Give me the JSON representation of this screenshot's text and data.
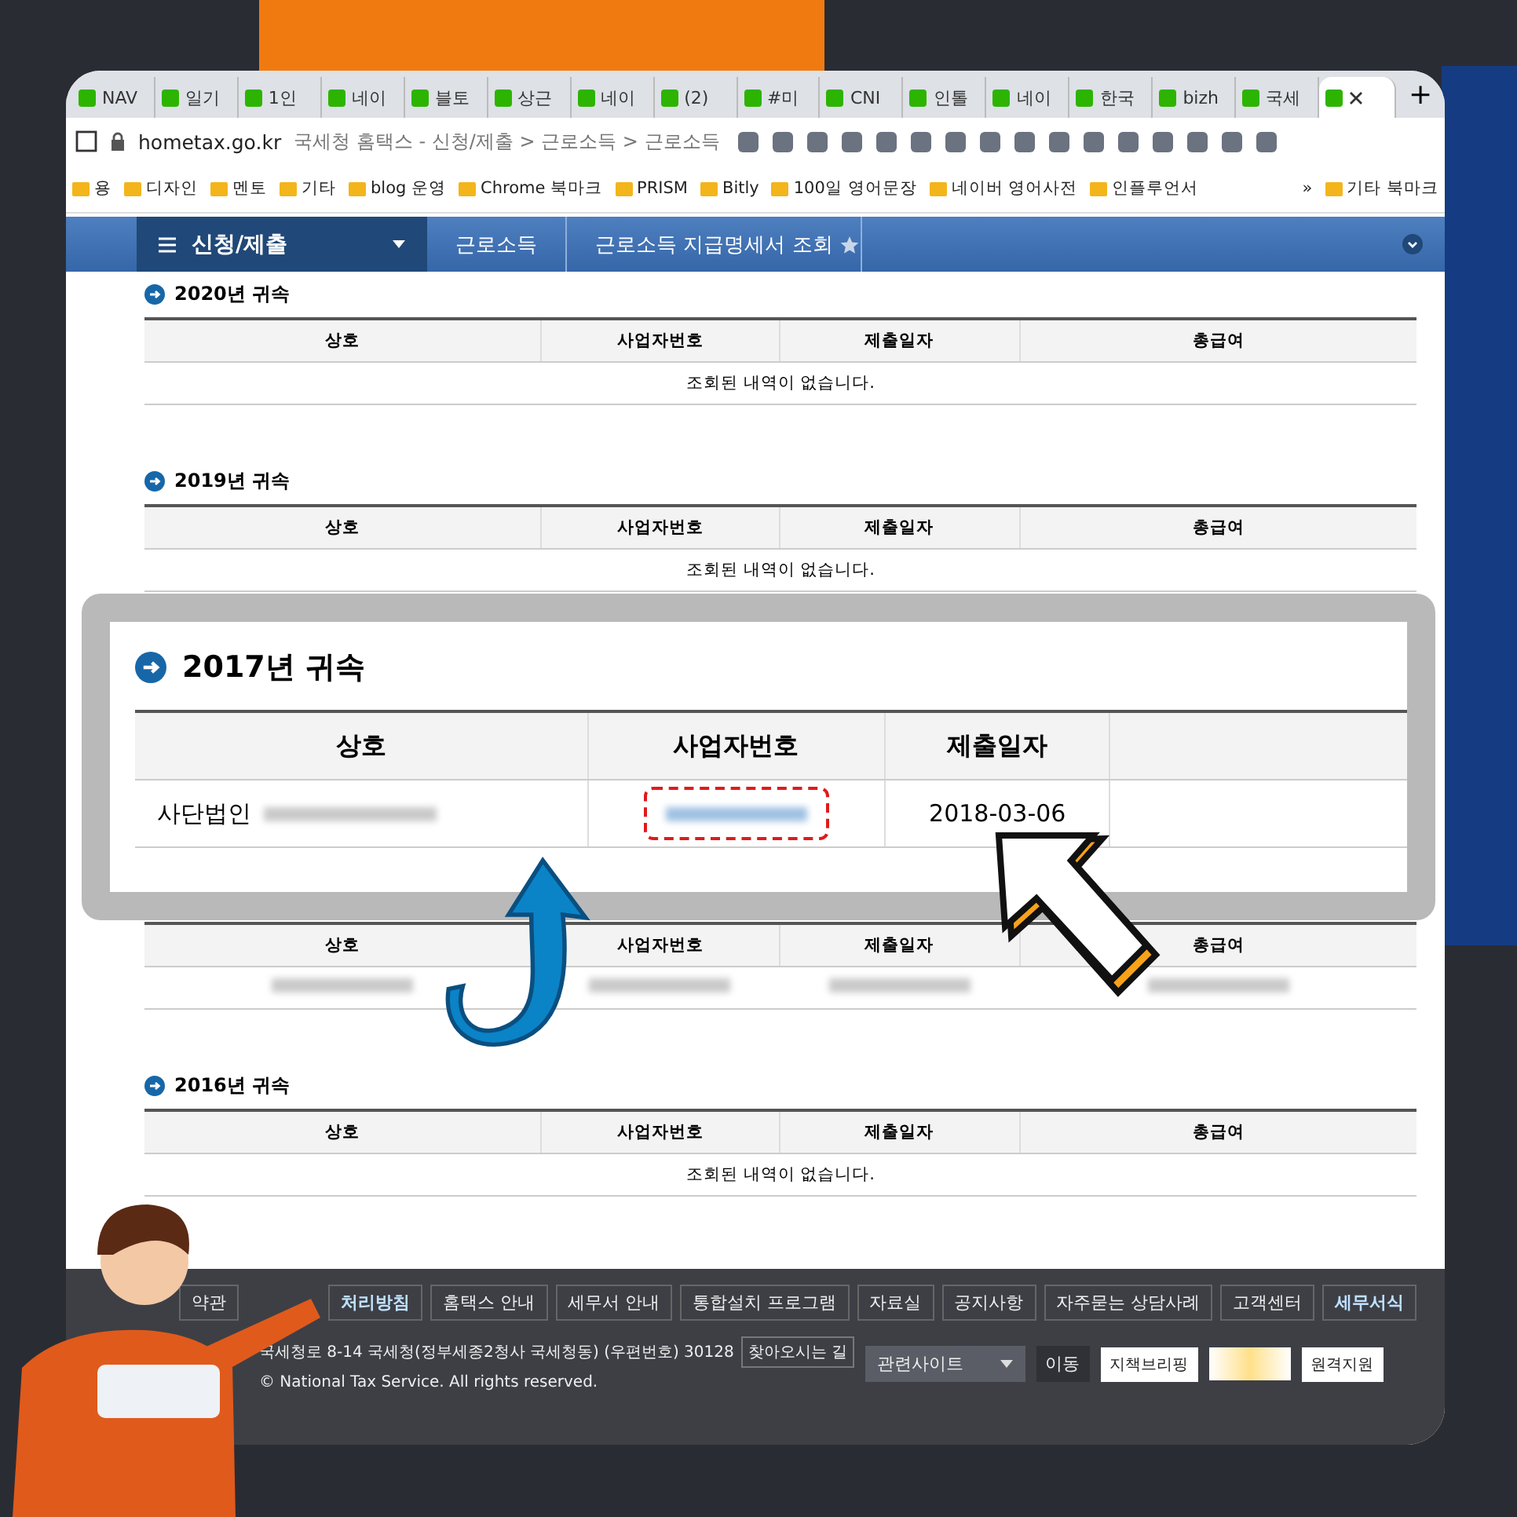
{
  "browser": {
    "tabs": [
      {
        "label": "NAV",
        "selected": false
      },
      {
        "label": "일기",
        "selected": false
      },
      {
        "label": "1인",
        "selected": false
      },
      {
        "label": "네이",
        "selected": false
      },
      {
        "label": "블토",
        "selected": false
      },
      {
        "label": "상근",
        "selected": false
      },
      {
        "label": "네이",
        "selected": false
      },
      {
        "label": "(2)",
        "selected": false
      },
      {
        "label": "#미",
        "selected": false
      },
      {
        "label": "CNI",
        "selected": false
      },
      {
        "label": "인톨",
        "selected": false
      },
      {
        "label": "네이",
        "selected": false
      },
      {
        "label": "한국",
        "selected": false
      },
      {
        "label": "bizh",
        "selected": false
      },
      {
        "label": "국세",
        "selected": false
      },
      {
        "selected": true
      }
    ],
    "new_tab": "+",
    "address": {
      "domain": "hometax.go.kr",
      "title": "국세청 홈택스 - 신청/제출 > 근로소득 > 근로소득"
    },
    "bookmarks": [
      "용",
      "디자인",
      "멘토",
      "기타",
      "blog 운영",
      "Chrome 북마크",
      "PRISM",
      "Bitly",
      "100일 영어문장",
      "네이버 영어사전",
      "인플루언서"
    ],
    "bookmarks_more": "»",
    "other_bookmarks": "기타 북마크"
  },
  "nav": {
    "menu": "신청/제출",
    "crumbs": [
      "근로소득",
      "근로소득 지급명세서 조회"
    ]
  },
  "sections": [
    {
      "title": "2020년 귀속",
      "columns": [
        "상호",
        "사업자번호",
        "제출일자",
        "총급여"
      ],
      "empty": "조회된 내역이 없습니다.",
      "blurred": false
    },
    {
      "title": "2019년 귀속",
      "columns": [
        "상호",
        "사업자번호",
        "제출일자",
        "총급여"
      ],
      "empty": "조회된 내역이 없습니다.",
      "blurred": false
    },
    {
      "columns": [
        "상호",
        "사업자번호",
        "제출일자",
        "총급여"
      ],
      "blurred": true
    },
    {
      "title": "2016년 귀속",
      "columns": [
        "상호",
        "사업자번호",
        "제출일자",
        "총급여"
      ],
      "empty": "조회된 내역이 없습니다.",
      "blurred": false
    }
  ],
  "callout": {
    "title": "2017년 귀속",
    "columns": [
      "상호",
      "사업자번호",
      "제출일자"
    ],
    "row": {
      "name": "사단법인",
      "date": "2018-03-06"
    }
  },
  "footer": {
    "links": [
      {
        "label": "약관",
        "selected": false
      },
      {
        "label": "처리방침",
        "selected": true
      },
      {
        "label": "홈택스 안내",
        "selected": false
      },
      {
        "label": "세무서 안내",
        "selected": false
      },
      {
        "label": "통합설치 프로그램",
        "selected": false
      },
      {
        "label": "자료실",
        "selected": false
      },
      {
        "label": "공지사항",
        "selected": false
      },
      {
        "label": "자주묻는 상담사례",
        "selected": false
      },
      {
        "label": "고객센터",
        "selected": false
      },
      {
        "label": "세무서식",
        "selected": true
      }
    ],
    "address": "국세청로 8-14 국세청(정부세종2청사 국세청동) (우편번호) 30128",
    "directions": "찾아오시는 길",
    "copyright": "© National Tax Service. All rights reserved.",
    "site_select": "관련사이트",
    "go": "이동",
    "briefing": "지책브리핑",
    "remote": "원격지원"
  }
}
